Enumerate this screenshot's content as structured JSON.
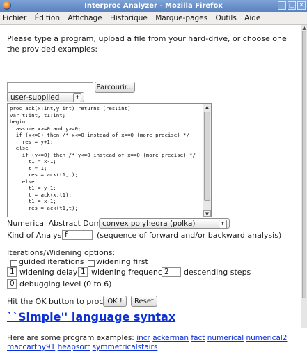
{
  "window": {
    "title": "Interproc Analyzer - Mozilla Firefox",
    "buttons": [
      "_",
      "□",
      "✕"
    ]
  },
  "menubar": {
    "items": [
      "Fichier",
      "Édition",
      "Affichage",
      "Historique",
      "Marque-pages",
      "Outils",
      "Aide"
    ]
  },
  "page": {
    "intro": "Please type a program, upload a file from your hard-drive, or choose one the provided examples:",
    "file_input_value": "",
    "browse_button": "Parcourir...",
    "program_select": "user-supplied",
    "code_lines": [
      "proc ack(x:int,y:int) returns (res:int)",
      "var t:int, t1:int;",
      "begin",
      "  assume x>=0 and y>=0;",
      "  if (x<=0) then /* x<=0 instead of x==0 (more precise) */",
      "    res = y+1;",
      "  else",
      "    if (y<=0) then /* y<=0 instead of x==0 (more precise) */",
      "      t1 = x-1;",
      "      t = 1;",
      "      res = ack(t1,t);",
      "    else",
      "      t1 = y-1;",
      "      t = ack(x,t1);",
      "      t1 = x-1;",
      "      res = ack(t1,t);"
    ],
    "domain_label": "Numerical Abstract Domain:",
    "domain_select": "convex polyhedra (polka)",
    "analysis_label": "Kind of Analysis:",
    "analysis_value": "f",
    "analysis_hint": "(sequence of forward and/or backward analysis)",
    "iter_heading": "Iterations/Widening options:",
    "guided_iterations": "guided iterations",
    "widening_first": "widening first",
    "widening_delay_value": "1",
    "widening_delay_label": "widening delay",
    "widening_freq_value": "1",
    "widening_freq_label": "widening frequency",
    "descending_value": "2",
    "descending_label": "descending steps",
    "debug_value": "0",
    "debug_label": "debugging level (0 to 6)",
    "proceed_label": "Hit the OK button to proceed:",
    "ok_button": "OK !",
    "reset_button": "Reset",
    "syntax_heading": "``Simple'' language syntax",
    "examples_prefix": "Here are some program examples:",
    "example_links": [
      "incr",
      "ackerman",
      "fact",
      "numerical",
      "numerical2",
      "maccarthy91",
      "heapsort",
      "symmetricalstairs"
    ]
  }
}
